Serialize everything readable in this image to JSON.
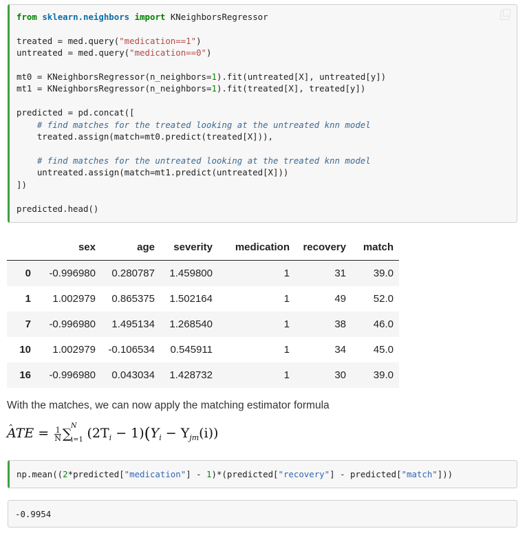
{
  "code_cell_1": {
    "lines": {
      "import": {
        "kw1": "from",
        "module": "sklearn.neighbors",
        "kw2": "import",
        "name": "KNeighborsRegressor"
      },
      "treated": {
        "pre": "treated = med.query(",
        "str": "\"medication==1\"",
        "post": ")"
      },
      "untreated": {
        "pre": "untreated = med.query(",
        "str": "\"medication==0\"",
        "post": ")"
      },
      "mt0": {
        "pre": "mt0 = KNeighborsRegressor(n_neighbors=",
        "num": "1",
        "post": ").fit(untreated[X], untreated[y])"
      },
      "mt1": {
        "pre": "mt1 = KNeighborsRegressor(n_neighbors=",
        "num": "1",
        "post": ").fit(treated[X], treated[y])"
      },
      "concat_open": "predicted = pd.concat([",
      "comment1": "    # find matches for the treated looking at the untreated knn model",
      "assign1": "    treated.assign(match=mt0.predict(treated[X])),",
      "comment2": "    # find matches for the untreated looking at the treated knn model",
      "assign2": "    untreated.assign(match=mt1.predict(untreated[X]))",
      "concat_close": "])",
      "head": "predicted.head()"
    }
  },
  "dataframe": {
    "columns": [
      "",
      "sex",
      "age",
      "severity",
      "medication",
      "recovery",
      "match"
    ],
    "rows": [
      {
        "index": "0",
        "values": [
          "-0.996980",
          "0.280787",
          "1.459800",
          "1",
          "31",
          "39.0"
        ]
      },
      {
        "index": "1",
        "values": [
          "1.002979",
          "0.865375",
          "1.502164",
          "1",
          "49",
          "52.0"
        ]
      },
      {
        "index": "7",
        "values": [
          "-0.996980",
          "1.495134",
          "1.268540",
          "1",
          "38",
          "46.0"
        ]
      },
      {
        "index": "10",
        "values": [
          "1.002979",
          "-0.106534",
          "0.545911",
          "1",
          "34",
          "45.0"
        ]
      },
      {
        "index": "16",
        "values": [
          "-0.996980",
          "0.043034",
          "1.428732",
          "1",
          "30",
          "39.0"
        ]
      }
    ]
  },
  "prose": "With the matches, we can now apply the matching estimator formula",
  "formula": {
    "lhs": "ATE",
    "hat": "̂",
    "eq": "=",
    "frac_num": "1",
    "frac_den": "N",
    "sum": "∑",
    "sum_sup": "N",
    "sum_sub": "i=1",
    "term1": "(2T",
    "term1_sub": "i",
    "term1_end": " − 1)",
    "term2_open": "(",
    "term2_y": "Y",
    "term2_ysub": "i",
    "term2_minus": " − Y",
    "term2_jm": "jm",
    "term2_end": "(i))"
  },
  "code_cell_2": {
    "pre": "np.mean((",
    "num2": "2",
    "mid1": "*predicted[",
    "str1": "\"medication\"",
    "mid2": "] - ",
    "num1": "1",
    "mid3": ")*(predicted[",
    "str2": "\"recovery\"",
    "mid4": "] - predicted[",
    "str3": "\"match\"",
    "end": "]))"
  },
  "output_cell": {
    "value": "-0.9954"
  }
}
